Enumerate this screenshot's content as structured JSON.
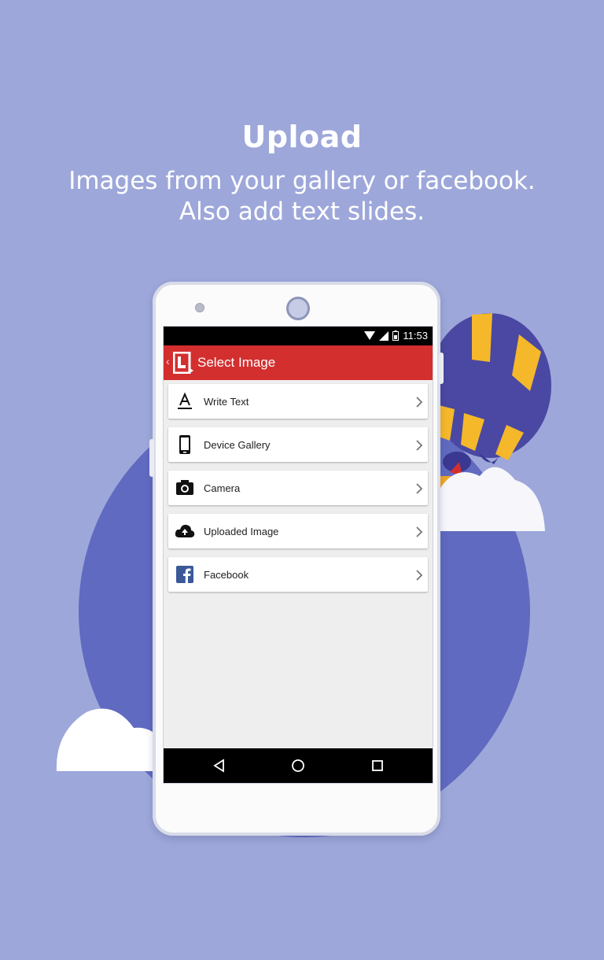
{
  "promo": {
    "title": "Upload",
    "subtitle_line1": "Images from your gallery or facebook.",
    "subtitle_line2": "Also add text slides."
  },
  "status_bar": {
    "time": "11:53",
    "icons": [
      "wifi-icon",
      "signal-icon",
      "battery-icon"
    ]
  },
  "app_bar": {
    "title": "Select Image",
    "accent": "#d32f2f"
  },
  "menu": {
    "items": [
      {
        "label": "Write Text",
        "icon": "text-icon"
      },
      {
        "label": "Device Gallery",
        "icon": "phone-icon"
      },
      {
        "label": "Camera",
        "icon": "camera-icon"
      },
      {
        "label": "Uploaded Image",
        "icon": "cloud-upload-icon"
      },
      {
        "label": "Facebook",
        "icon": "facebook-icon"
      }
    ]
  },
  "nav_bar": {
    "buttons": [
      "back-icon",
      "home-icon",
      "recent-apps-icon"
    ]
  },
  "colors": {
    "background": "#9da7da",
    "circle": "#5f6ac0",
    "balloon_blue": "#4a48a2",
    "balloon_yellow": "#f5b82a",
    "facebook": "#3b5998"
  }
}
